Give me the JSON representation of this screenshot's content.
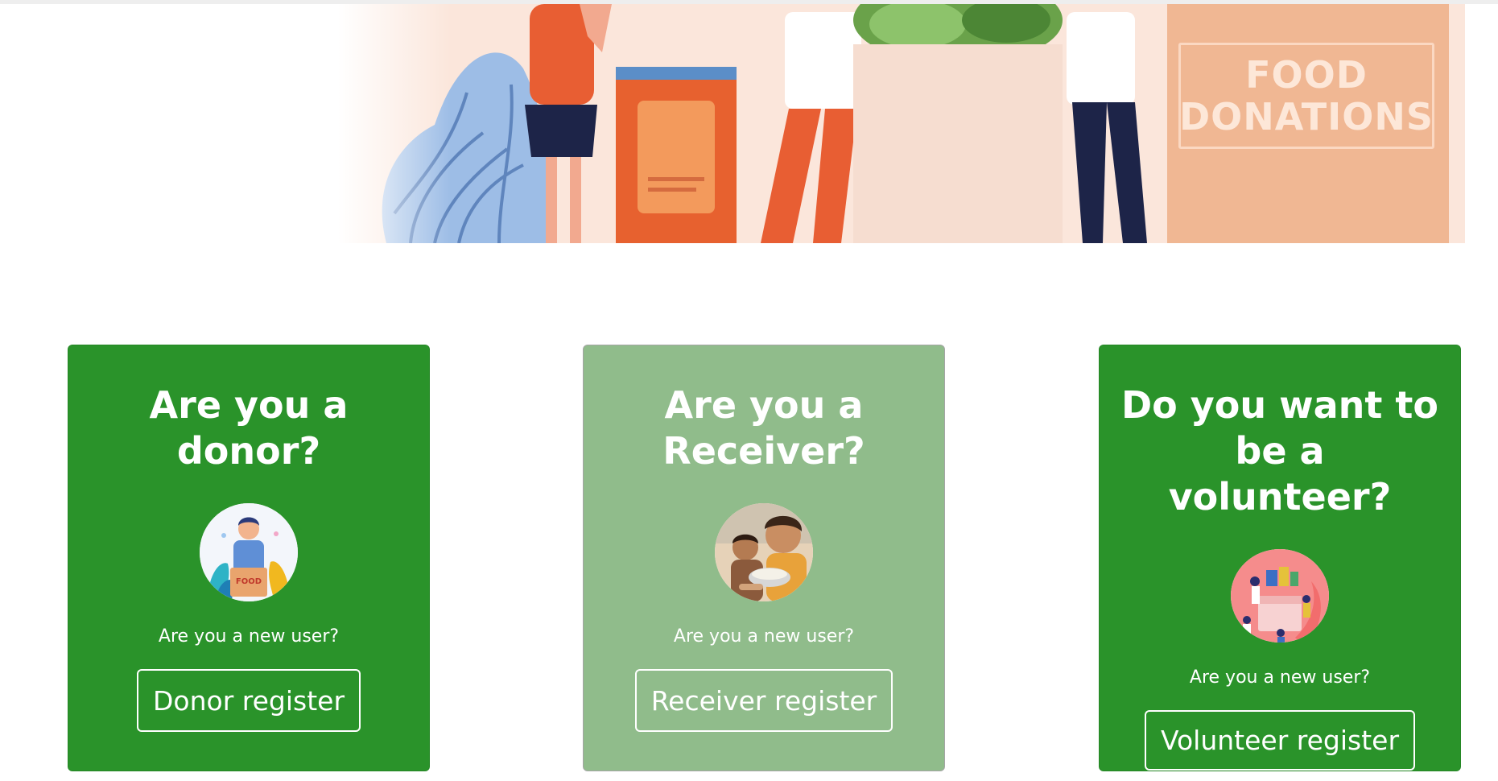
{
  "hero": {
    "sign_lines": [
      "FOOD",
      "DONATIONS"
    ]
  },
  "cards": [
    {
      "title": "Are you a donor?",
      "prompt": "Are you a new user?",
      "button_label": "Donor register",
      "background": "#2a932a",
      "avatar_text": "FOOD"
    },
    {
      "title": "Are you a Receiver?",
      "prompt": "Are you a new user?",
      "button_label": "Receiver register",
      "background": "#90bc8b"
    },
    {
      "title": "Do you want to be a volunteer?",
      "prompt": "Are you a new user?",
      "button_label": "Volunteer register",
      "background": "#2a932a"
    }
  ],
  "colors": {
    "green": "#2a932a",
    "light_green": "#90bc8b",
    "banner_bg": "#fbe6db",
    "sign": "#f0b793"
  }
}
